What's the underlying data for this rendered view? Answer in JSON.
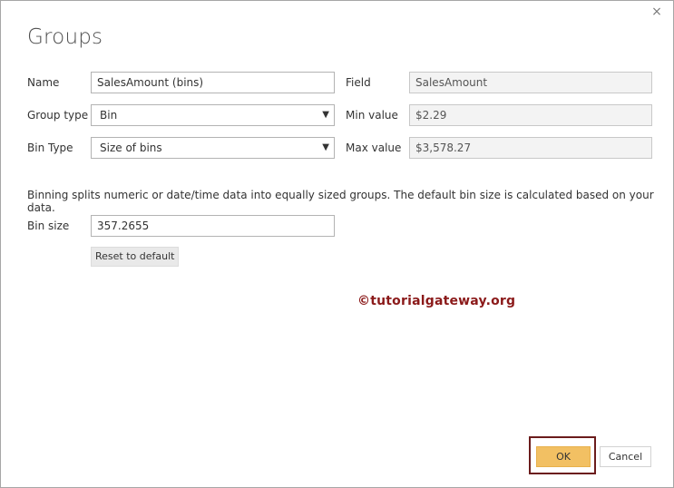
{
  "dialog": {
    "title": "Groups",
    "close_icon": "×"
  },
  "form": {
    "name_label": "Name",
    "name_value": "SalesAmount (bins)",
    "group_type_label": "Group type",
    "group_type_value": "Bin",
    "bin_type_label": "Bin Type",
    "bin_type_value": "Size of bins",
    "field_label": "Field",
    "field_value": "SalesAmount",
    "min_label": "Min value",
    "min_value": "$2.29",
    "max_label": "Max value",
    "max_value": "$3,578.27",
    "description": "Binning splits numeric or date/time data into equally sized groups. The default bin size is calculated based on your data.",
    "bin_size_label": "Bin size",
    "bin_size_value": "357.2655",
    "reset_label": "Reset to default"
  },
  "watermark": "©tutorialgateway.org",
  "footer": {
    "ok_label": "OK",
    "cancel_label": "Cancel"
  },
  "colors": {
    "ok_button": "#f2c063",
    "highlight_border": "#6b1c1c",
    "watermark": "#8b1a1a"
  },
  "icons": {
    "dropdown": "chevron-down-icon",
    "close": "close-icon"
  }
}
